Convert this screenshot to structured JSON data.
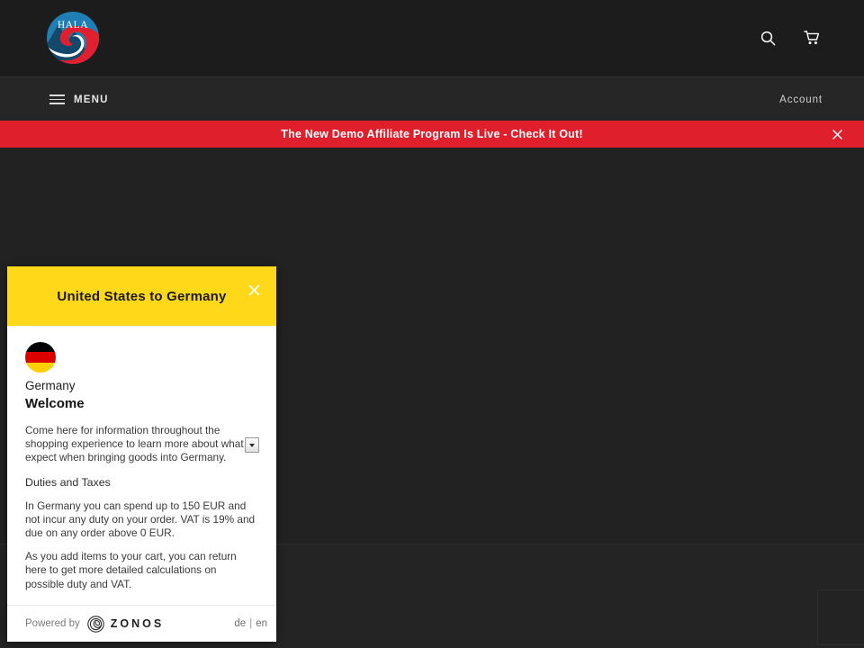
{
  "site": {
    "logo_text": "HALA",
    "logo_alt": "Hala logo"
  },
  "header": {
    "search_icon": "search-icon",
    "cart_icon": "cart-icon"
  },
  "menubar": {
    "menu_label": "MENU",
    "account_label": "Account",
    "menu_icon": "hamburger-icon"
  },
  "announcement": {
    "text": "The New Demo Affiliate Program Is Live - Check It Out!",
    "close_label": "×",
    "background_color": "#e01f2d",
    "text_color": "#ffffff"
  },
  "zonos_popup": {
    "title": "United States to Germany",
    "close_label": "×",
    "header_color": "#ffd919",
    "country": "Germany",
    "flag_colors": [
      "#000000",
      "#dd0000",
      "#ffce00"
    ],
    "welcome_heading": "Welcome",
    "intro_paragraph": "Come here for information throughout the shopping experience to learn more about what to expect when bringing goods into Germany.",
    "duties_heading": "Duties and Taxes",
    "duties_paragraph": "In Germany you can spend up to 150 EUR and not incur any duty on your order. VAT is 19% and due on any order above 0 EUR.",
    "cart_paragraph": "As you add items to your cart, you can return here to get more detailed calculations on possible duty and VAT.",
    "footer": {
      "powered_by": "Powered by",
      "brand": "ZONOS",
      "lang_de": "de",
      "lang_separator": "|",
      "lang_en": "en"
    }
  }
}
